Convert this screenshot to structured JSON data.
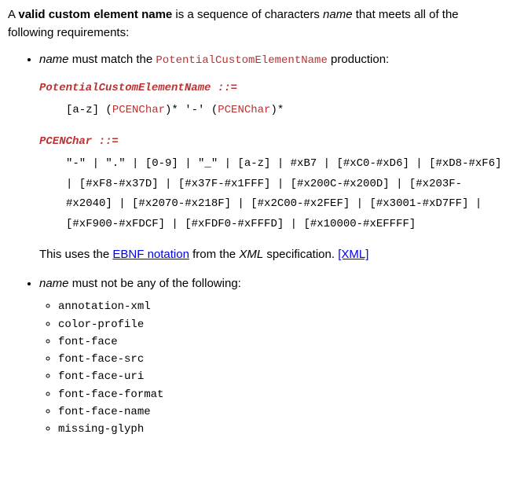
{
  "intro": {
    "pre": "A ",
    "dfn": "valid custom element name",
    "mid": " is a sequence of characters ",
    "var": "name",
    "post": " that meets all of the following requirements:"
  },
  "item1": {
    "var": "name",
    "mid": " must match the ",
    "prod": "PotentialCustomElementName",
    "post": " production:"
  },
  "grammar": {
    "r1name": "PotentialCustomElementName ::=",
    "r1body_a": "[a-z] (",
    "r1body_pcen1": "PCENChar",
    "r1body_b": ")* '-' (",
    "r1body_pcen2": "PCENChar",
    "r1body_c": ")*",
    "r2name": "PCENChar ::=",
    "r2body": "\"-\" | \".\" | [0-9] | \"_\" | [a-z] | #xB7 | [#xC0-#xD6] | [#xD8-#xF6] | [#xF8-#x37D] | [#x37F-#x1FFF] | [#x200C-#x200D] | [#x203F-#x2040] | [#x2070-#x218F] | [#x2C00-#x2FEF] | [#x3001-#xD7FF] | [#xF900-#xFDCF] | [#xFDF0-#xFFFD] | [#x10000-#xEFFFF]"
  },
  "ebnf_sentence": {
    "a": "This uses the ",
    "link": "EBNF notation",
    "b": " from the ",
    "spec": "XML",
    "c": " specification. ",
    "ref": "[XML]"
  },
  "item2": {
    "var": "name",
    "post": " must not be any of the following:"
  },
  "banned": [
    "annotation-xml",
    "color-profile",
    "font-face",
    "font-face-src",
    "font-face-uri",
    "font-face-format",
    "font-face-name",
    "missing-glyph"
  ]
}
